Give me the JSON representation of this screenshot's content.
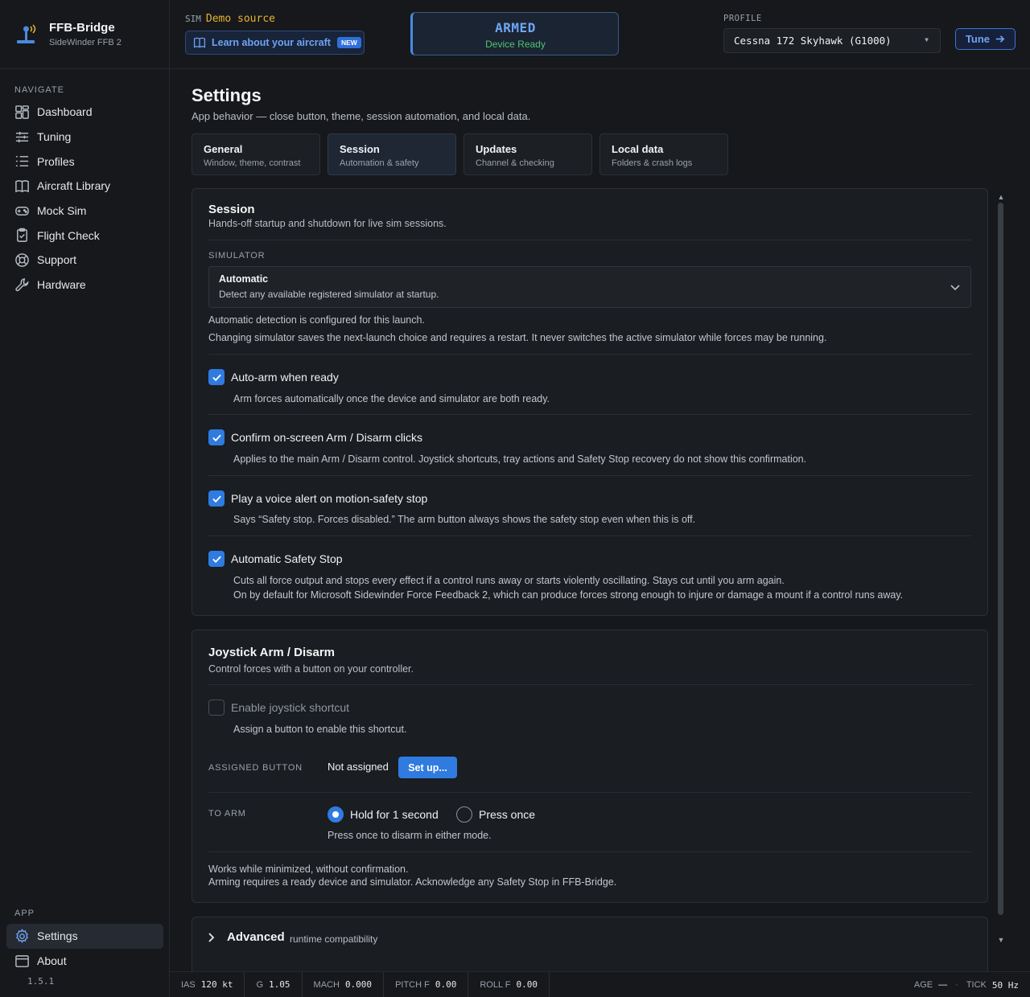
{
  "app": {
    "name": "FFB-Bridge",
    "device": "SideWinder FFB 2",
    "version": "1.5.1"
  },
  "sidebar": {
    "nav_label": "NAVIGATE",
    "items": [
      {
        "label": "Dashboard",
        "icon": "dashboard-icon"
      },
      {
        "label": "Tuning",
        "icon": "sliders-icon"
      },
      {
        "label": "Profiles",
        "icon": "list-icon"
      },
      {
        "label": "Aircraft Library",
        "icon": "book-icon"
      },
      {
        "label": "Mock Sim",
        "icon": "gamepad-icon"
      },
      {
        "label": "Flight Check",
        "icon": "clipboard-check-icon"
      },
      {
        "label": "Support",
        "icon": "lifebuoy-icon"
      },
      {
        "label": "Hardware",
        "icon": "wrench-icon"
      }
    ],
    "app_label": "APP",
    "app_items": [
      {
        "label": "Settings",
        "icon": "gear-icon",
        "active": true
      },
      {
        "label": "About",
        "icon": "window-icon"
      }
    ]
  },
  "topbar": {
    "sim_label": "SIM",
    "sim_value": "Demo source",
    "learn_label": "Learn about your aircraft",
    "new_badge": "NEW",
    "armed_title": "ARMED",
    "armed_sub": "Device Ready",
    "profile_label": "PROFILE",
    "profile_value": "Cessna 172 Skyhawk (G1000)",
    "tune_label": "Tune"
  },
  "page": {
    "title": "Settings",
    "subtitle": "App behavior — close button, theme, session automation, and local data.",
    "tabs": [
      {
        "title": "General",
        "sub": "Window, theme, contrast"
      },
      {
        "title": "Session",
        "sub": "Automation & safety",
        "active": true
      },
      {
        "title": "Updates",
        "sub": "Channel & checking"
      },
      {
        "title": "Local data",
        "sub": "Folders & crash logs"
      }
    ]
  },
  "session": {
    "title": "Session",
    "subtitle": "Hands-off startup and shutdown for live sim sessions.",
    "simulator_label": "SIMULATOR",
    "simulator_value": "Automatic",
    "simulator_desc": "Detect any available registered simulator at startup.",
    "note1": "Automatic detection is configured for this launch.",
    "note2": "Changing simulator saves the next-launch choice and requires a restart. It never switches the active simulator while forces may be running.",
    "options": [
      {
        "label": "Auto-arm when ready",
        "checked": true,
        "desc": [
          "Arm forces automatically once the device and simulator are both ready."
        ]
      },
      {
        "label": "Confirm on-screen Arm / Disarm clicks",
        "checked": true,
        "desc": [
          "Applies to the main Arm / Disarm control. Joystick shortcuts, tray actions and Safety Stop recovery do not show this confirmation."
        ]
      },
      {
        "label": "Play a voice alert on motion-safety stop",
        "checked": true,
        "desc": [
          "Says “Safety stop. Forces disabled.” The arm button always shows the safety stop even when this is off."
        ]
      },
      {
        "label": "Automatic Safety Stop",
        "checked": true,
        "desc": [
          "Cuts all force output and stops every effect if a control runs away or starts violently oscillating. Stays cut until you arm again.",
          "On by default for Microsoft Sidewinder Force Feedback 2, which can produce forces strong enough to injure or damage a mount if a control runs away."
        ]
      }
    ]
  },
  "joystick": {
    "title": "Joystick Arm / Disarm",
    "subtitle": "Control forces with a button on your controller.",
    "enable_label": "Enable joystick shortcut",
    "enable_checked": false,
    "enable_desc": "Assign a button to enable this shortcut.",
    "assigned_label": "ASSIGNED BUTTON",
    "assigned_value": "Not assigned",
    "setup_label": "Set up...",
    "to_arm_label": "TO ARM",
    "radio_hold": "Hold for 1 second",
    "radio_press": "Press once",
    "selected": "hold",
    "radio_note": "Press once to disarm in either mode.",
    "footer1": "Works while minimized, without confirmation.",
    "footer2": "Arming requires a ready device and simulator. Acknowledge any Safety Stop in FFB-Bridge."
  },
  "advanced": {
    "title": "Advanced",
    "sub": "runtime compatibility"
  },
  "statusbar": {
    "items": [
      {
        "label": "IAS",
        "value": "120 kt"
      },
      {
        "label": "G",
        "value": "1.05"
      },
      {
        "label": "MACH",
        "value": "0.000"
      },
      {
        "label": "PITCH F",
        "value": "0.00"
      },
      {
        "label": "ROLL F",
        "value": "0.00"
      }
    ],
    "age_label": "AGE",
    "age_value": "—",
    "tick_label": "TICK",
    "tick_value": "50 Hz"
  },
  "colors": {
    "accent": "#2f7be0",
    "sim_value": "#e7b431",
    "armed": "#6ea6f4",
    "ready": "#4fc270"
  }
}
